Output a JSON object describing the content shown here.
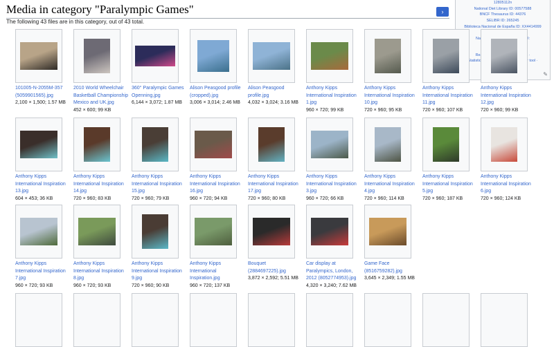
{
  "page": {
    "title": "Media in category \"Paralympic Games\"",
    "count_text": "The following 43 files are in this category, out of 43 total."
  },
  "sidebar": {
    "rows": [
      "12805112n",
      "National Diet Library ID: 00577588",
      "BNCF Thesaurus ID: 44376",
      "SELIBR ID: 265245",
      "Biblioteca Nacional de España ID: XX4414999",
      "BabelNet ID: 03527926n",
      "National Library of Israel J9U ID:",
      "987007380777005171",
      "",
      "Reasonator · PetScan · Scholia ·",
      "Statistics · OpenStreetMap · Locator tool ·",
      "Search depicted"
    ]
  },
  "icons": {
    "next": "arrow-right-icon",
    "edit": "pencil-icon",
    "external": "external-link-icon"
  },
  "colors": {
    "link": "#3366cc",
    "button": "#3366cc",
    "border": "#c8ccd1"
  },
  "files": [
    {
      "name": [
        "101005-N-2055M-357",
        "(5059901565).jpg"
      ],
      "meta": "2,100 × 1,500; 1.57 MB",
      "shape": "land",
      "c1": "#b8a488",
      "c2": "#2e2a26"
    },
    {
      "name": [
        "2010 World Wheelchair",
        "Basketball Championship",
        "Mexico and UK.jpg"
      ],
      "meta": "452 × 600; 99 KB",
      "shape": "port",
      "c1": "#6d6a74",
      "c2": "#cdc6c0"
    },
    {
      "name": [
        "360° Paralympic Games",
        "Openning.jpg"
      ],
      "meta": "6,144 × 3,072; 1.87 MB",
      "shape": "wide",
      "c1": "#2c2c5a",
      "c2": "#d04a8a"
    },
    {
      "name": [
        "Alison Peasgood profile",
        "(cropped).jpg"
      ],
      "meta": "3,006 × 3,014; 2.46 MB",
      "shape": "sq",
      "c1": "#7fa9d4",
      "c2": "#3a6f8d"
    },
    {
      "name": [
        "Alison Peasgood",
        "profile.jpg"
      ],
      "meta": "4,032 × 3,024; 3.16 MB",
      "shape": "land",
      "c1": "#8fb3d6",
      "c2": "#4b7288"
    },
    {
      "name": [
        "Anthony Kipps",
        "International Inspiration",
        "1.jpg"
      ],
      "meta": "960 × 720; 99 KB",
      "shape": "land",
      "c1": "#6b8a4a",
      "c2": "#a86a3c"
    },
    {
      "name": [
        "Anthony Kipps",
        "International Inspiration",
        "10.jpg"
      ],
      "meta": "720 × 960; 95 KB",
      "shape": "port",
      "c1": "#9c9a8e",
      "c2": "#555a4e"
    },
    {
      "name": [
        "Anthony Kipps",
        "International Inspiration",
        "11.jpg"
      ],
      "meta": "720 × 960; 107 KB",
      "shape": "port",
      "c1": "#9aa0a6",
      "c2": "#3d4a5a"
    },
    {
      "name": [
        "Anthony Kipps",
        "International Inspiration",
        "12.jpg"
      ],
      "meta": "720 × 960; 99 KB",
      "shape": "port",
      "c1": "#b0b4ba",
      "c2": "#4a5462"
    },
    {
      "name": [
        "Anthony Kipps",
        "International Inspiration",
        "13.jpg"
      ],
      "meta": "604 × 453; 36 KB",
      "shape": "land",
      "c1": "#3a2e2a",
      "c2": "#6fc0c8"
    },
    {
      "name": [
        "Anthony Kipps",
        "International Inspiration",
        "14.jpg"
      ],
      "meta": "720 × 960; 83 KB",
      "shape": "port",
      "c1": "#5a3a2a",
      "c2": "#6ac4d0"
    },
    {
      "name": [
        "Anthony Kipps",
        "International Inspiration",
        "15.jpg"
      ],
      "meta": "720 × 960; 79 KB",
      "shape": "port",
      "c1": "#4a3e36",
      "c2": "#5ab8c6"
    },
    {
      "name": [
        "Anthony Kipps",
        "International Inspiration",
        "16.jpg"
      ],
      "meta": "960 × 720; 94 KB",
      "shape": "land",
      "c1": "#6a5a4a",
      "c2": "#a04a4a"
    },
    {
      "name": [
        "Anthony Kipps",
        "International Inspiration",
        "17.jpg"
      ],
      "meta": "720 × 960; 80 KB",
      "shape": "port",
      "c1": "#5a3c2c",
      "c2": "#62b2c2"
    },
    {
      "name": [
        "Anthony Kipps",
        "International Inspiration",
        "3.jpg"
      ],
      "meta": "960 × 720; 66 KB",
      "shape": "land",
      "c1": "#9cb4c8",
      "c2": "#4c5a4a"
    },
    {
      "name": [
        "Anthony Kipps",
        "International Inspiration",
        "4.jpg"
      ],
      "meta": "720 × 960; 114 KB",
      "shape": "port",
      "c1": "#a8b8c8",
      "c2": "#4e5444"
    },
    {
      "name": [
        "Anthony Kipps",
        "International Inspiration",
        "5.jpg"
      ],
      "meta": "720 × 960; 187 KB",
      "shape": "port",
      "c1": "#5a8a3a",
      "c2": "#2e3a2a"
    },
    {
      "name": [
        "Anthony Kipps",
        "International Inspiration",
        "6.jpg"
      ],
      "meta": "720 × 960; 124 KB",
      "shape": "port",
      "c1": "#e8e4e0",
      "c2": "#c84a3a"
    },
    {
      "name": [
        "Anthony Kipps",
        "International Inspiration",
        "7.jpg"
      ],
      "meta": "960 × 720; 93 KB",
      "shape": "land",
      "c1": "#b8c4d0",
      "c2": "#4e6a3a"
    },
    {
      "name": [
        "Anthony Kipps",
        "International Inspiration",
        "8.jpg"
      ],
      "meta": "960 × 720; 93 KB",
      "shape": "land",
      "c1": "#7a9a5a",
      "c2": "#3e4a3e"
    },
    {
      "name": [
        "Anthony Kipps",
        "International Inspiration",
        "9.jpg"
      ],
      "meta": "720 × 960; 90 KB",
      "shape": "port",
      "c1": "#4a3c34",
      "c2": "#5ab8c8"
    },
    {
      "name": [
        "Anthony Kipps",
        "International",
        "Inspiration.jpg"
      ],
      "meta": "960 × 720; 137 KB",
      "shape": "land",
      "c1": "#7a9a6a",
      "c2": "#4e5e3e"
    },
    {
      "name": [
        "Bouquet",
        "(2884697225).jpg"
      ],
      "meta": "3,872 × 2,592; 5.51 MB",
      "shape": "land",
      "c1": "#2a2a2a",
      "c2": "#b83a3a"
    },
    {
      "name": [
        "Car display at",
        "Paralympics, London,",
        "2012 (8052774953).jpg"
      ],
      "meta": "4,320 × 3,240; 7.62 MB",
      "shape": "land",
      "c1": "#3a3a3e",
      "c2": "#c83a3a"
    },
    {
      "name": [
        "Game Face",
        "(8516759282).jpg"
      ],
      "meta": "3,645 × 2,349; 1.55 MB",
      "shape": "land",
      "c1": "#c89a5a",
      "c2": "#6a4a2a"
    }
  ]
}
